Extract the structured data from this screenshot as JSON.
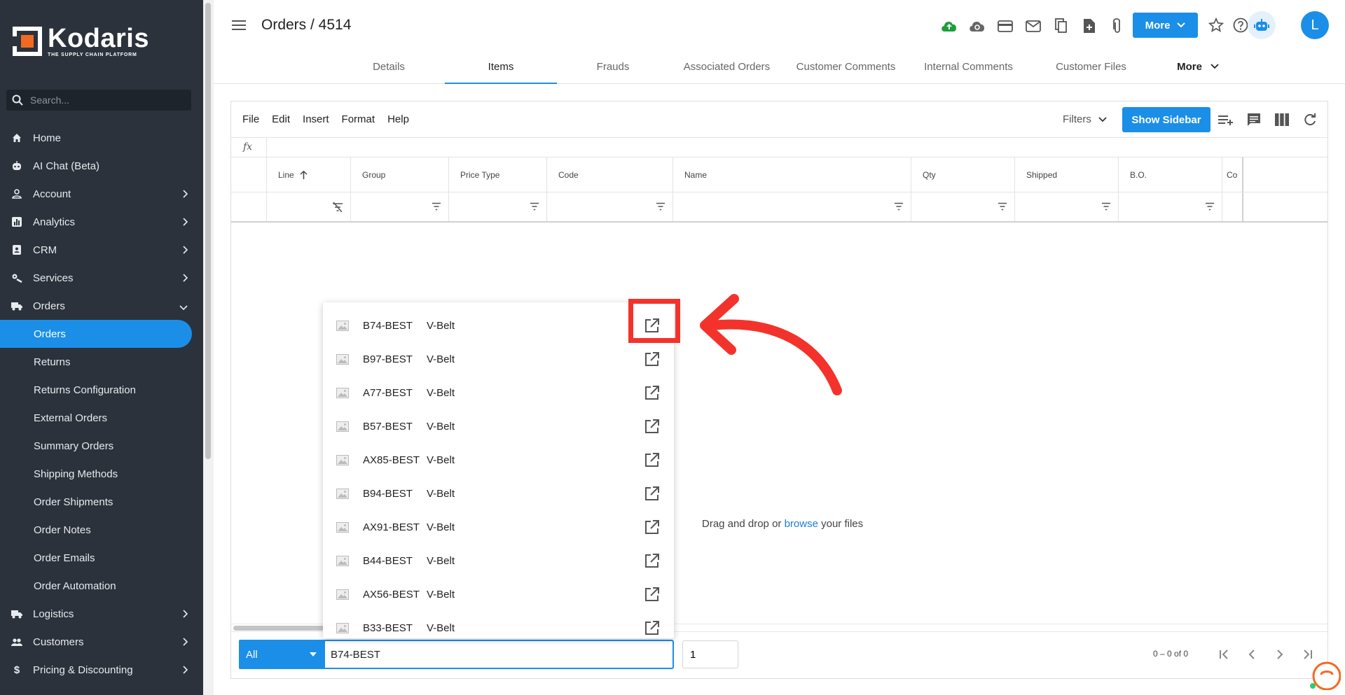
{
  "brand": {
    "name": "Kodaris",
    "tagline": "THE SUPPLY CHAIN PLATFORM",
    "accent": "#1b8ee8",
    "sidebar_bg": "#2b323b"
  },
  "sidebar": {
    "search_placeholder": "Search...",
    "items": [
      {
        "label": "Home",
        "icon": "home-icon",
        "chevron": false
      },
      {
        "label": "AI Chat (Beta)",
        "icon": "robot-icon",
        "chevron": false
      },
      {
        "label": "Account",
        "icon": "person-icon",
        "chevron": true
      },
      {
        "label": "Analytics",
        "icon": "chart-icon",
        "chevron": true
      },
      {
        "label": "CRM",
        "icon": "contact-icon",
        "chevron": true
      },
      {
        "label": "Services",
        "icon": "services-icon",
        "chevron": true
      },
      {
        "label": "Orders",
        "icon": "truck-icon",
        "chevron": "down"
      }
    ],
    "order_subitems": [
      "Orders",
      "Returns",
      "Returns Configuration",
      "External Orders",
      "Summary Orders",
      "Shipping Methods",
      "Order Shipments",
      "Order Notes",
      "Order Emails",
      "Order Automation"
    ],
    "bottom_items": [
      {
        "label": "Logistics",
        "icon": "truck-icon"
      },
      {
        "label": "Customers",
        "icon": "people-icon"
      },
      {
        "label": "Pricing & Discounting",
        "icon": "dollar-icon"
      }
    ]
  },
  "header": {
    "title": "Orders / 4514",
    "more_label": "More",
    "avatar_letter": "L",
    "tabs": [
      "Details",
      "Items",
      "Frauds",
      "Associated Orders",
      "Customer Comments",
      "Internal Comments",
      "Customer Files"
    ],
    "tabs_more": "More",
    "active_tab": "Items"
  },
  "grid": {
    "menu": [
      "File",
      "Edit",
      "Insert",
      "Format",
      "Help"
    ],
    "filters_label": "Filters",
    "show_sidebar_label": "Show Sidebar",
    "fx_label": "fx",
    "columns": [
      "Line",
      "Group",
      "Price Type",
      "Code",
      "Name",
      "Qty",
      "Shipped",
      "B.O.",
      "Co"
    ],
    "drop_prefix": "Drag and drop or ",
    "drop_link": "browse",
    "drop_suffix": " your files",
    "range_text": "0 – 0 of 0"
  },
  "add_line": {
    "scope_value": "All",
    "code_value": "B74-BEST",
    "qty_value": "1"
  },
  "dropdown": [
    {
      "code": "B74-BEST",
      "name": "V-Belt"
    },
    {
      "code": "B97-BEST",
      "name": "V-Belt"
    },
    {
      "code": "A77-BEST",
      "name": "V-Belt"
    },
    {
      "code": "B57-BEST",
      "name": "V-Belt"
    },
    {
      "code": "AX85-BEST",
      "name": "V-Belt"
    },
    {
      "code": "B94-BEST",
      "name": "V-Belt"
    },
    {
      "code": "AX91-BEST",
      "name": "V-Belt"
    },
    {
      "code": "B44-BEST",
      "name": "V-Belt"
    },
    {
      "code": "AX56-BEST",
      "name": "V-Belt"
    },
    {
      "code": "B33-BEST",
      "name": "V-Belt"
    }
  ],
  "annotation_color": "#f3332b"
}
